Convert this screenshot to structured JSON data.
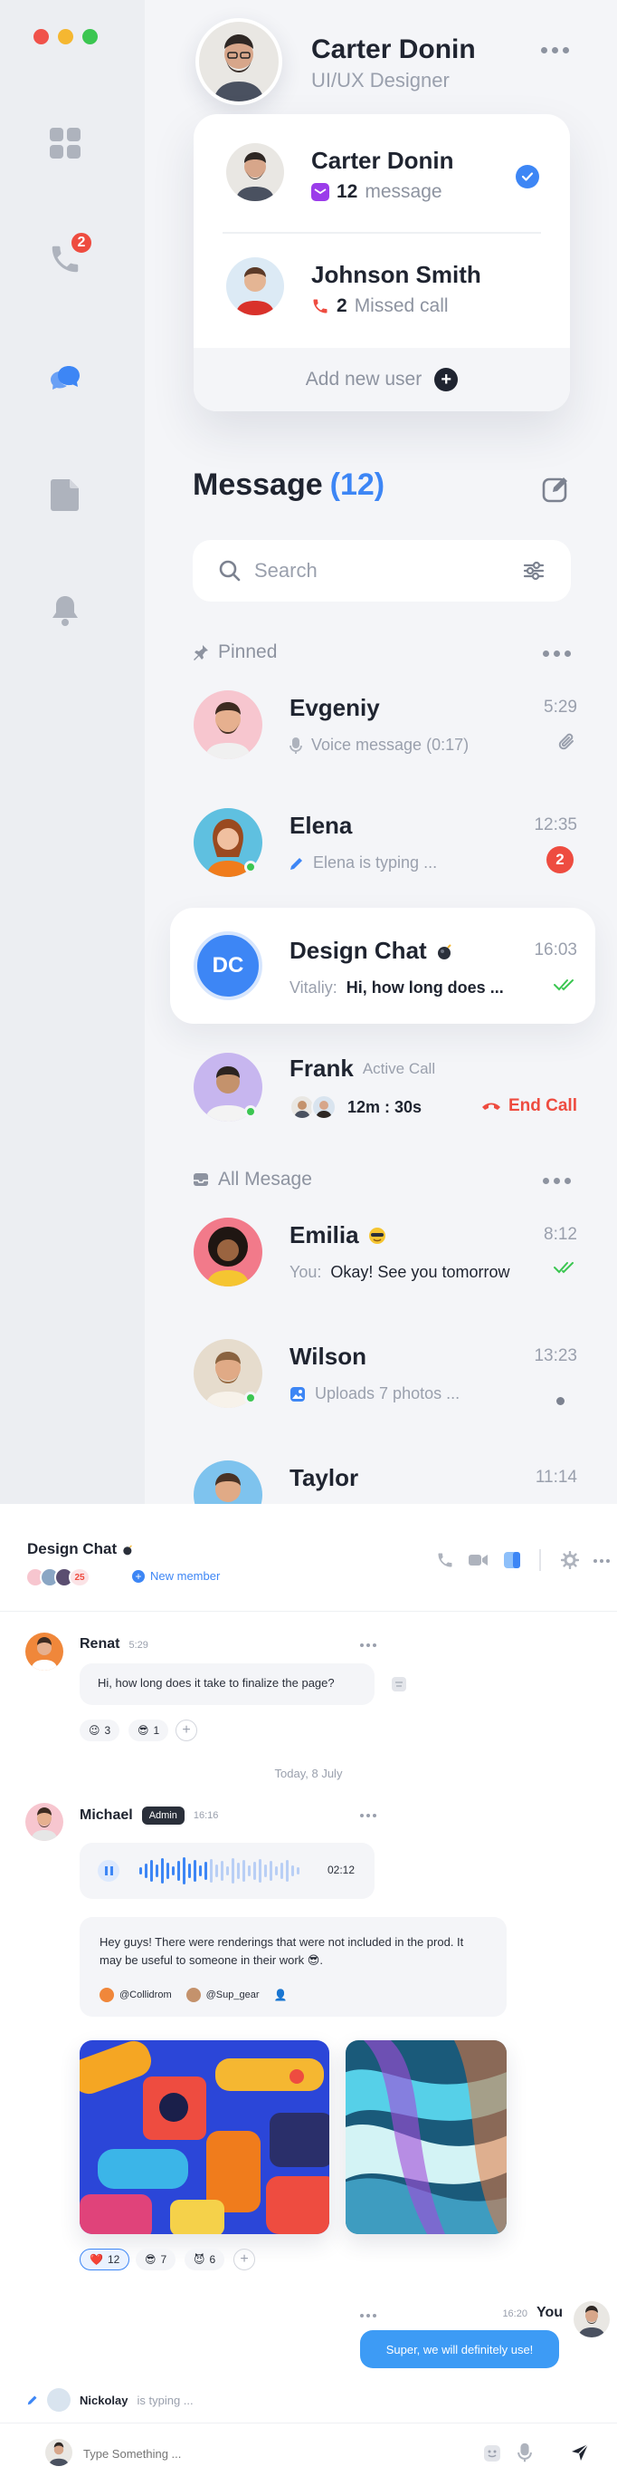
{
  "profile": {
    "name": "Carter Donin",
    "role": "UI/UX Designer"
  },
  "sidebar": {
    "nav": [
      "grid-icon",
      "phone-icon",
      "chat-icon",
      "document-icon",
      "bell-icon"
    ],
    "calls_badge": "2"
  },
  "user_switcher": {
    "users": [
      {
        "name": "Carter Donin",
        "count": "12",
        "detail": "message"
      },
      {
        "name": "Johnson Smith",
        "count": "2",
        "detail": "Missed call"
      }
    ],
    "add_label": "Add new user"
  },
  "messages": {
    "title": "Message",
    "count": "(12)"
  },
  "search": {
    "placeholder": "Search"
  },
  "pinned_label": "Pinned",
  "all_label": "All Mesage",
  "chats": {
    "evgeniy": {
      "name": "Evgeniy",
      "time": "5:29",
      "preview": "Voice message (0:17)"
    },
    "elena": {
      "name": "Elena",
      "time": "12:35",
      "preview": "Elena is typing ...",
      "badge": "2"
    },
    "design": {
      "name": "Design Chat",
      "initials": "DC",
      "time": "16:03",
      "sender": "Vitaliy:",
      "preview": "Hi, how long does ..."
    },
    "frank": {
      "name": "Frank",
      "status": "Active Call",
      "duration": "12m : 30s",
      "action": "End Call"
    },
    "emilia": {
      "name": "Emilia",
      "time": "8:12",
      "prefix": "You:",
      "preview": "Okay! See you tomorrow"
    },
    "wilson": {
      "name": "Wilson",
      "time": "13:23",
      "preview": "Uploads 7 photos ..."
    },
    "taylor": {
      "name": "Taylor",
      "time": "11:14"
    }
  },
  "conversation": {
    "title": "Design Chat",
    "members_extra": "25",
    "new_member": "New member",
    "renat": {
      "name": "Renat",
      "time": "5:29",
      "text": "Hi, how long does it take to finalize the page?",
      "reactions": [
        {
          "emoji": "😉",
          "count": "3"
        },
        {
          "emoji": "😎",
          "count": "1"
        }
      ]
    },
    "date_divider": "Today, 8 July",
    "michael": {
      "name": "Michael",
      "badge": "Admin",
      "time": "16:16",
      "voice_duration": "02:12",
      "text": "Hey guys! There were renderings that were not included in the prod. It may be useful to someone in their work 😎.",
      "mentions": [
        "@Collidrom",
        "@Sup_gear"
      ],
      "reactions": [
        {
          "emoji": "❤️",
          "count": "12"
        },
        {
          "emoji": "😎",
          "count": "7"
        },
        {
          "emoji": "😈",
          "count": "6"
        }
      ]
    },
    "you": {
      "name": "You",
      "time": "16:20",
      "text": "Super, we will definitely use!"
    },
    "typing": {
      "name": "Nickolay",
      "text": "is typing ..."
    },
    "composer": {
      "placeholder": "Type Something ..."
    }
  },
  "colors": {
    "accent": "#3d86f5",
    "danger": "#ee4c40",
    "online": "#3bc651"
  }
}
